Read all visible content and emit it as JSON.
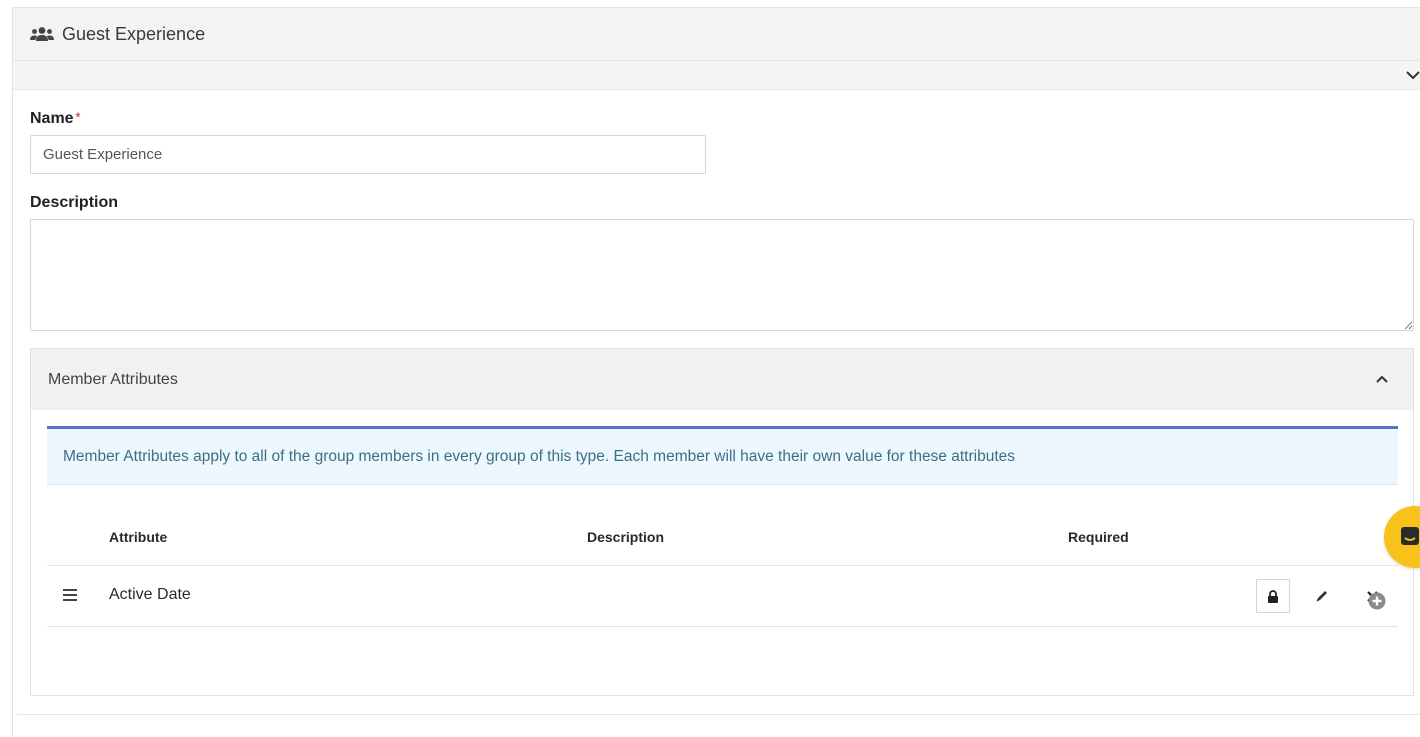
{
  "panel": {
    "title": "Guest Experience"
  },
  "form": {
    "name_label": "Name",
    "required_marker": "*",
    "name_value": "Guest Experience",
    "description_label": "Description",
    "description_value": ""
  },
  "member_attributes": {
    "title": "Member Attributes",
    "info": "Member Attributes apply to all of the group members in every group of this type. Each member will have their own value for these attributes",
    "columns": {
      "attribute": "Attribute",
      "description": "Description",
      "required": "Required"
    },
    "rows": [
      {
        "attribute": "Active Date",
        "description": "",
        "required": ""
      }
    ]
  },
  "icons": {
    "header": "users-icon",
    "expand": "chevron-down-icon",
    "collapse": "chevron-up-icon",
    "drag": "bars-icon",
    "lock": "lock-icon",
    "edit": "pencil-icon",
    "delete": "times-icon",
    "add": "plus-circle-icon",
    "fab": "chat-icon"
  },
  "colors": {
    "required": "#d9534f",
    "alert_border": "#5b6fc7",
    "alert_bg": "#ecf8fd",
    "fab": "#f6c21b"
  }
}
